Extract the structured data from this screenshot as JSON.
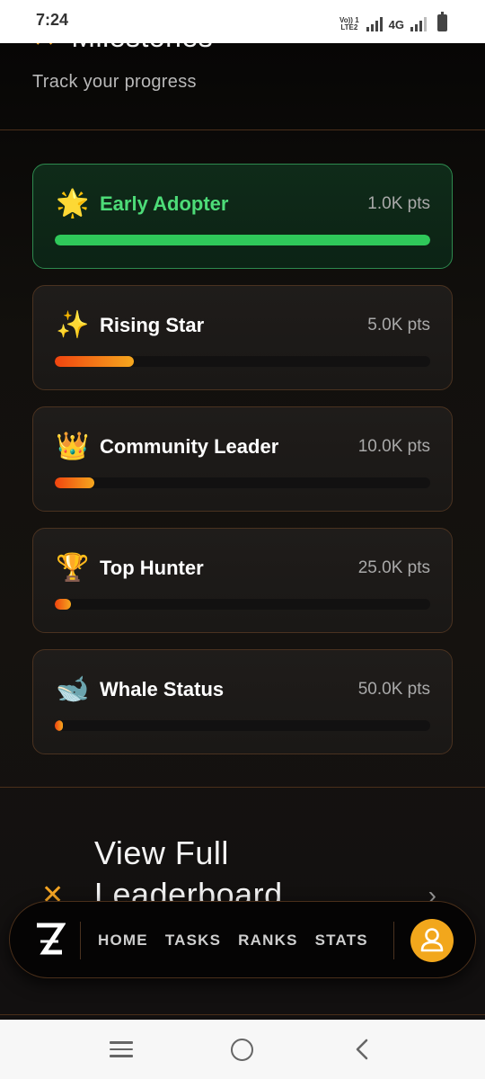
{
  "status_bar": {
    "time": "7:24",
    "volte_line1": "Vo)) 1",
    "volte_line2": "LTE2",
    "network": "4G"
  },
  "header": {
    "title_partial": "Milestones",
    "title_icon": "x-icon",
    "subtitle": "Track your progress"
  },
  "milestones": [
    {
      "emoji": "🌟",
      "icon": "glowing-star-icon",
      "title": "Early Adopter",
      "points": "1.0K pts",
      "progress": 1.0,
      "completed": true
    },
    {
      "emoji": "✨",
      "icon": "sparkles-icon",
      "title": "Rising Star",
      "points": "5.0K pts",
      "progress": 0.21,
      "completed": false
    },
    {
      "emoji": "👑",
      "icon": "crown-icon",
      "title": "Community Leader",
      "points": "10.0K pts",
      "progress": 0.105,
      "completed": false
    },
    {
      "emoji": "🏆",
      "icon": "trophy-icon",
      "title": "Top Hunter",
      "points": "25.0K pts",
      "progress": 0.042,
      "completed": false
    },
    {
      "emoji": "🐋",
      "icon": "whale-icon",
      "title": "Whale Status",
      "points": "50.0K pts",
      "progress": 0.021,
      "completed": false
    }
  ],
  "leaderboard_link": {
    "label": "View Full Leaderboard",
    "icon": "x-icon",
    "arrow_icon": "chevron-right-icon"
  },
  "bottom_nav": {
    "logo_icon": "z-logo-icon",
    "items": [
      "HOME",
      "TASKS",
      "RANKS",
      "STATS"
    ],
    "avatar_icon": "user-icon"
  },
  "colors": {
    "accent": "#f5a524",
    "success": "#2fc85a",
    "progress_start": "#f0440f",
    "progress_end": "#f5a71e",
    "card_border": "#4a3220"
  }
}
